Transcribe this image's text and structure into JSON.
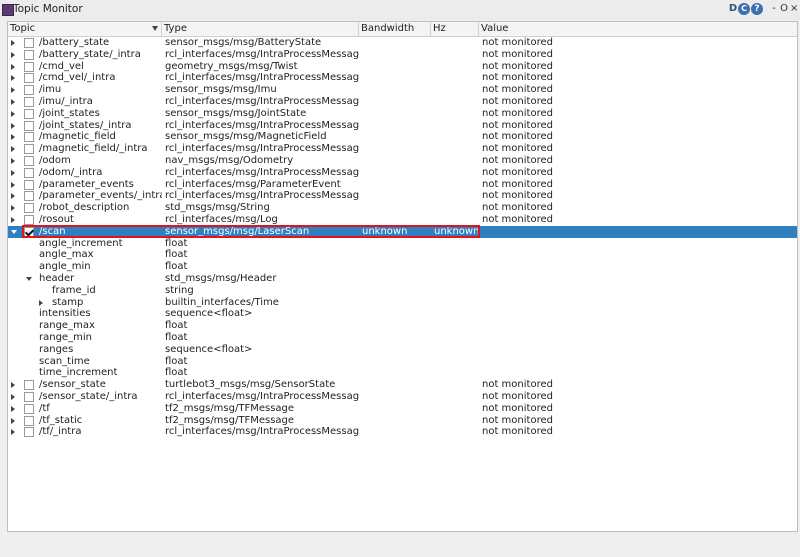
{
  "window": {
    "title": "Topic Monitor",
    "buttons": {
      "d": "D",
      "c": "C",
      "help": "?",
      "minimize": "-",
      "restore": "O",
      "close": "×"
    }
  },
  "columns": {
    "topic": "Topic",
    "type": "Type",
    "bandwidth": "Bandwidth",
    "hz": "Hz",
    "value": "Value"
  },
  "rows": [
    {
      "topic": "/battery_state",
      "type": "sensor_msgs/msg/BatteryState",
      "value": "not monitored"
    },
    {
      "topic": "/battery_state/_intra",
      "type": "rcl_interfaces/msg/IntraProcessMessage",
      "value": "not monitored"
    },
    {
      "topic": "/cmd_vel",
      "type": "geometry_msgs/msg/Twist",
      "value": "not monitored"
    },
    {
      "topic": "/cmd_vel/_intra",
      "type": "rcl_interfaces/msg/IntraProcessMessage",
      "value": "not monitored"
    },
    {
      "topic": "/imu",
      "type": "sensor_msgs/msg/Imu",
      "value": "not monitored"
    },
    {
      "topic": "/imu/_intra",
      "type": "rcl_interfaces/msg/IntraProcessMessage",
      "value": "not monitored"
    },
    {
      "topic": "/joint_states",
      "type": "sensor_msgs/msg/JointState",
      "value": "not monitored"
    },
    {
      "topic": "/joint_states/_intra",
      "type": "rcl_interfaces/msg/IntraProcessMessage",
      "value": "not monitored"
    },
    {
      "topic": "/magnetic_field",
      "type": "sensor_msgs/msg/MagneticField",
      "value": "not monitored"
    },
    {
      "topic": "/magnetic_field/_intra",
      "type": "rcl_interfaces/msg/IntraProcessMessage",
      "value": "not monitored"
    },
    {
      "topic": "/odom",
      "type": "nav_msgs/msg/Odometry",
      "value": "not monitored"
    },
    {
      "topic": "/odom/_intra",
      "type": "rcl_interfaces/msg/IntraProcessMessage",
      "value": "not monitored"
    },
    {
      "topic": "/parameter_events",
      "type": "rcl_interfaces/msg/ParameterEvent",
      "value": "not monitored"
    },
    {
      "topic": "/parameter_events/_intra",
      "type": "rcl_interfaces/msg/IntraProcessMessage",
      "value": "not monitored"
    },
    {
      "topic": "/robot_description",
      "type": "std_msgs/msg/String",
      "value": "not monitored"
    },
    {
      "topic": "/rosout",
      "type": "rcl_interfaces/msg/Log",
      "value": "not monitored"
    },
    {
      "topic": "/scan",
      "type": "sensor_msgs/msg/LaserScan",
      "bandwidth": "unknown",
      "hz": "unknown",
      "value": "",
      "selected": true,
      "expanded": true,
      "checked": true
    },
    {
      "topic": "angle_increment",
      "type": "float",
      "child": 1
    },
    {
      "topic": "angle_max",
      "type": "float",
      "child": 1
    },
    {
      "topic": "angle_min",
      "type": "float",
      "child": 1
    },
    {
      "topic": "header",
      "type": "std_msgs/msg/Header",
      "child": 1,
      "expanded": true
    },
    {
      "topic": "frame_id",
      "type": "string",
      "child": 2
    },
    {
      "topic": "stamp",
      "type": "builtin_interfaces/Time",
      "child": 2,
      "collapsed": true
    },
    {
      "topic": "intensities",
      "type": "sequence<float>",
      "child": 1
    },
    {
      "topic": "range_max",
      "type": "float",
      "child": 1
    },
    {
      "topic": "range_min",
      "type": "float",
      "child": 1
    },
    {
      "topic": "ranges",
      "type": "sequence<float>",
      "child": 1
    },
    {
      "topic": "scan_time",
      "type": "float",
      "child": 1
    },
    {
      "topic": "time_increment",
      "type": "float",
      "child": 1
    },
    {
      "topic": "/sensor_state",
      "type": "turtlebot3_msgs/msg/SensorState",
      "value": "not monitored"
    },
    {
      "topic": "/sensor_state/_intra",
      "type": "rcl_interfaces/msg/IntraProcessMessage",
      "value": "not monitored"
    },
    {
      "topic": "/tf",
      "type": "tf2_msgs/msg/TFMessage",
      "value": "not monitored"
    },
    {
      "topic": "/tf_static",
      "type": "tf2_msgs/msg/TFMessage",
      "value": "not monitored"
    },
    {
      "topic": "/tf/_intra",
      "type": "rcl_interfaces/msg/IntraProcessMessage",
      "value": "not monitored"
    }
  ],
  "colors": {
    "selection": "#2f7fc1",
    "highlight_box": "#e0141b"
  }
}
